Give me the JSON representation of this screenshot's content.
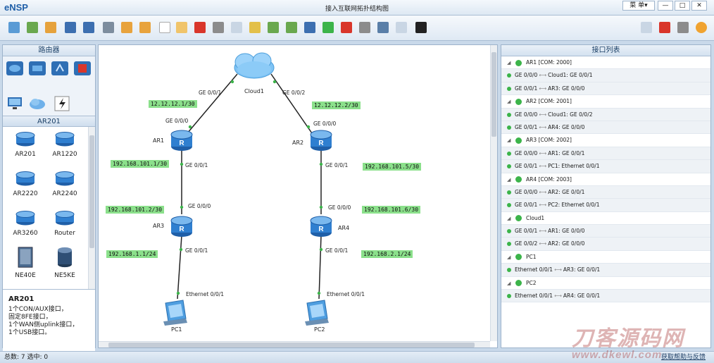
{
  "window": {
    "app_name": "eNSP",
    "title": "接入互联网拓扑结构图",
    "menu_label": "菜 单▾",
    "min": "—",
    "max": "□",
    "close": "✕"
  },
  "left_panel": {
    "header": "路由器",
    "sub_header": "AR201",
    "models": [
      {
        "name": "AR201"
      },
      {
        "name": "AR1220"
      },
      {
        "name": "AR2220"
      },
      {
        "name": "AR2240"
      },
      {
        "name": "AR3260"
      },
      {
        "name": "Router"
      },
      {
        "name": "NE40E"
      },
      {
        "name": "NE5KE"
      }
    ],
    "desc_title": "AR201",
    "desc_lines": [
      "1个CON/AUX接口，",
      "固定8FE接口，",
      "1个WAN侧uplink接口，",
      "1个USB接口。"
    ]
  },
  "topology": {
    "devices": {
      "cloud1": "Cloud1",
      "ar1": "AR1",
      "ar2": "AR2",
      "ar3": "AR3",
      "ar4": "AR4",
      "pc1": "PC1",
      "pc2": "PC2"
    },
    "ports": {
      "cloud_left": "GE 0/0/1",
      "cloud_right": "GE 0/0/2",
      "ar1_top": "GE 0/0/0",
      "ar1_bottom": "GE 0/0/1",
      "ar2_top": "GE 0/0/0",
      "ar2_bottom": "GE 0/0/1",
      "ar3_top": "GE 0/0/0",
      "ar3_bottom": "GE 0/0/1",
      "ar4_top": "GE 0/0/0",
      "ar4_bottom": "GE 0/0/1",
      "pc1": "Ethernet 0/0/1",
      "pc2": "Ethernet 0/0/1"
    },
    "ips": {
      "ip1": "12.12.12.1/30",
      "ip2": "12.12.12.2/30",
      "ip3": "192.168.101.1/30",
      "ip4": "192.168.101.5/30",
      "ip5": "192.168.101.2/30",
      "ip6": "192.168.101.6/30",
      "ip7": "192.168.1.1/24",
      "ip8": "192.168.2.1/24"
    }
  },
  "right_panel": {
    "header": "接口列表",
    "items": [
      {
        "type": "head",
        "text": "AR1 [COM: 2000]"
      },
      {
        "type": "link",
        "a": "GE 0/0/0",
        "b": "Cloud1: GE 0/0/1"
      },
      {
        "type": "link",
        "a": "GE 0/0/1",
        "b": "AR3: GE 0/0/0"
      },
      {
        "type": "head",
        "text": "AR2 [COM: 2001]"
      },
      {
        "type": "link",
        "a": "GE 0/0/0",
        "b": "Cloud1: GE 0/0/2"
      },
      {
        "type": "link",
        "a": "GE 0/0/1",
        "b": "AR4: GE 0/0/0"
      },
      {
        "type": "head",
        "text": "AR3 [COM: 2002]"
      },
      {
        "type": "link",
        "a": "GE 0/0/0",
        "b": "AR1: GE 0/0/1"
      },
      {
        "type": "link",
        "a": "GE 0/0/1",
        "b": "PC1: Ethernet 0/0/1"
      },
      {
        "type": "head",
        "text": "AR4 [COM: 2003]"
      },
      {
        "type": "link",
        "a": "GE 0/0/0",
        "b": "AR2: GE 0/0/1"
      },
      {
        "type": "link",
        "a": "GE 0/0/1",
        "b": "PC2: Ethernet 0/0/1"
      },
      {
        "type": "head",
        "text": "Cloud1"
      },
      {
        "type": "link",
        "a": "GE 0/0/1",
        "b": "AR1: GE 0/0/0"
      },
      {
        "type": "link",
        "a": "GE 0/0/2",
        "b": "AR2: GE 0/0/0"
      },
      {
        "type": "head",
        "text": "PC1"
      },
      {
        "type": "link",
        "a": "Ethernet 0/0/1",
        "b": "AR3: GE 0/0/1"
      },
      {
        "type": "head",
        "text": "PC2"
      },
      {
        "type": "link",
        "a": "Ethernet 0/0/1",
        "b": "AR4: GE 0/0/1"
      }
    ]
  },
  "status": {
    "left": "总数: 7  选中: 0",
    "right": "获取帮助与反馈"
  },
  "watermark": {
    "line1": "刀客源码网",
    "line2": "www.dkewl.com"
  },
  "colors": {
    "ip_label_bg": "#8be08b",
    "link_dot": "#3cb44a",
    "router_blue": "#2f7fd0"
  }
}
